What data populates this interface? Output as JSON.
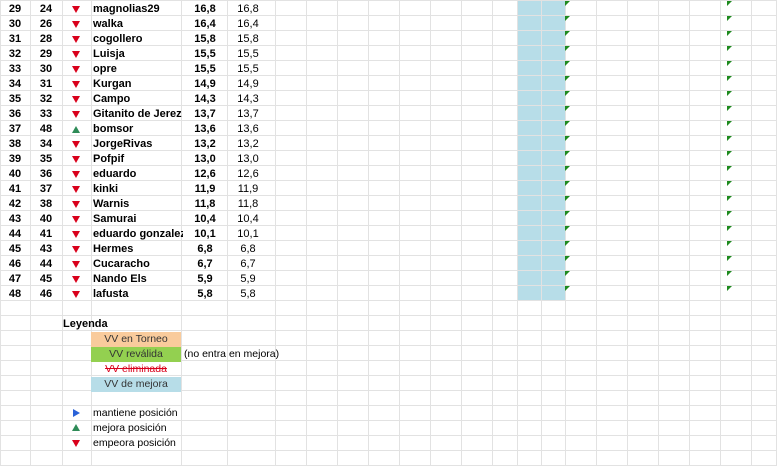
{
  "rows": [
    {
      "row": "29",
      "pos": "24",
      "trend": "down",
      "name": "magnolias29",
      "val": "16,8",
      "val2": "16,8"
    },
    {
      "row": "30",
      "pos": "26",
      "trend": "down",
      "name": "walka",
      "val": "16,4",
      "val2": "16,4"
    },
    {
      "row": "31",
      "pos": "28",
      "trend": "down",
      "name": "cogollero",
      "val": "15,8",
      "val2": "15,8"
    },
    {
      "row": "32",
      "pos": "29",
      "trend": "down",
      "name": "Luisja",
      "val": "15,5",
      "val2": "15,5"
    },
    {
      "row": "33",
      "pos": "30",
      "trend": "down",
      "name": "opre",
      "val": "15,5",
      "val2": "15,5"
    },
    {
      "row": "34",
      "pos": "31",
      "trend": "down",
      "name": "Kurgan",
      "val": "14,9",
      "val2": "14,9"
    },
    {
      "row": "35",
      "pos": "32",
      "trend": "down",
      "name": "Campo",
      "val": "14,3",
      "val2": "14,3"
    },
    {
      "row": "36",
      "pos": "33",
      "trend": "down",
      "name": "Gitanito de Jerez",
      "val": "13,7",
      "val2": "13,7"
    },
    {
      "row": "37",
      "pos": "48",
      "trend": "up",
      "name": "bomsor",
      "val": "13,6",
      "val2": "13,6"
    },
    {
      "row": "38",
      "pos": "34",
      "trend": "down",
      "name": "JorgeRivas",
      "val": "13,2",
      "val2": "13,2"
    },
    {
      "row": "39",
      "pos": "35",
      "trend": "down",
      "name": "Pofpif",
      "val": "13,0",
      "val2": "13,0"
    },
    {
      "row": "40",
      "pos": "36",
      "trend": "down",
      "name": "eduardo",
      "val": "12,6",
      "val2": "12,6"
    },
    {
      "row": "41",
      "pos": "37",
      "trend": "down",
      "name": "kinki",
      "val": "11,9",
      "val2": "11,9"
    },
    {
      "row": "42",
      "pos": "38",
      "trend": "down",
      "name": "Warnis",
      "val": "11,8",
      "val2": "11,8"
    },
    {
      "row": "43",
      "pos": "40",
      "trend": "down",
      "name": "Samurai",
      "val": "10,4",
      "val2": "10,4"
    },
    {
      "row": "44",
      "pos": "41",
      "trend": "down",
      "name": "eduardo gonzalez",
      "val": "10,1",
      "val2": "10,1"
    },
    {
      "row": "45",
      "pos": "43",
      "trend": "down",
      "name": "Hermes",
      "val": "6,8",
      "val2": "6,8"
    },
    {
      "row": "46",
      "pos": "44",
      "trend": "down",
      "name": "Cucaracho",
      "val": "6,7",
      "val2": "6,7"
    },
    {
      "row": "47",
      "pos": "45",
      "trend": "down",
      "name": "Nando Els",
      "val": "5,9",
      "val2": "5,9"
    },
    {
      "row": "48",
      "pos": "46",
      "trend": "down",
      "name": "lafusta",
      "val": "5,8",
      "val2": "5,8"
    }
  ],
  "legend": {
    "title": "Leyenda",
    "torneo": "VV en Torneo",
    "revalida": "VV reválida",
    "revalida_note": "(no entra en mejora)",
    "eliminada": "VV eliminada",
    "mejora": "VV de mejora",
    "mantiene": "mantiene posición",
    "mejora_pos": "mejora posición",
    "empeora": "empeora posición"
  },
  "colors": {
    "torneo": "#f9cb9c",
    "revalida": "#93d050",
    "mejora": "#b7dde8",
    "down": "#d9001b",
    "up": "#2e8b57",
    "same": "#2a62d8"
  }
}
